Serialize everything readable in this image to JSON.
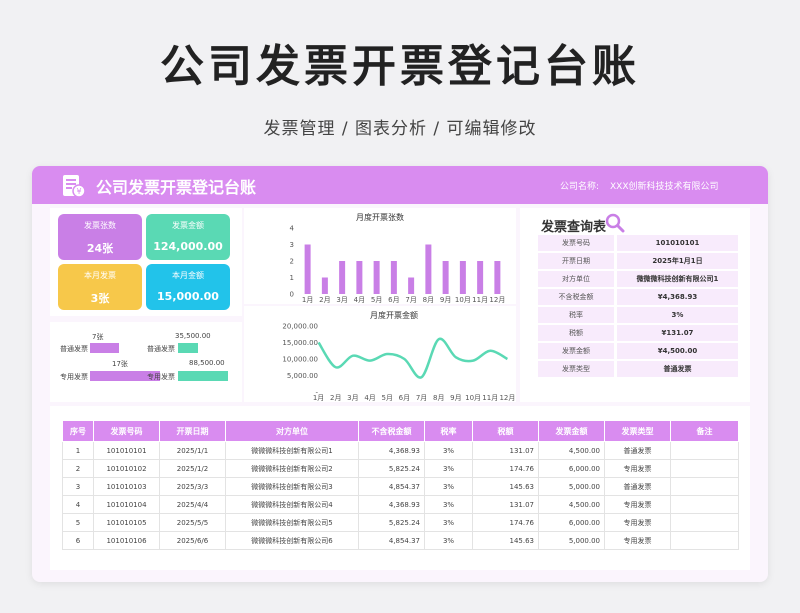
{
  "page": {
    "title": "公司发票开票登记台账",
    "subtitle": "发票管理 / 图表分析 / 可编辑修改"
  },
  "header": {
    "sheet_title": "公司发票开票登记台账",
    "company_label": "公司名称:",
    "company_value": "XXX创新科技技术有限公司"
  },
  "stats": [
    {
      "label": "发票张数",
      "value": "24张",
      "color": "#c97fe6"
    },
    {
      "label": "发票金额",
      "value": "124,000.00",
      "color": "#5ad9b4"
    },
    {
      "label": "本月发票",
      "value": "3张",
      "color": "#f7c84a"
    },
    {
      "label": "本月金额",
      "value": "15,000.00",
      "color": "#22c3ea"
    }
  ],
  "type_bars": [
    {
      "label": "普通发票",
      "count_label": "7张",
      "count": 7,
      "amount_label": "35,500.00",
      "amount": 35500
    },
    {
      "label": "专用发票",
      "count_label": "17张",
      "count": 17,
      "amount_label": "88,500.00",
      "amount": 88500
    }
  ],
  "chart_data": [
    {
      "type": "bar",
      "title": "月度开票张数",
      "categories": [
        "1月",
        "2月",
        "3月",
        "4月",
        "5月",
        "6月",
        "7月",
        "8月",
        "9月",
        "10月",
        "11月",
        "12月"
      ],
      "values": [
        3,
        1,
        2,
        2,
        2,
        2,
        1,
        3,
        2,
        2,
        2,
        2
      ],
      "ylim": [
        0,
        4
      ],
      "yticks": [
        "0",
        "1",
        "2",
        "3",
        "4"
      ],
      "color": "#c97fe6"
    },
    {
      "type": "line",
      "title": "月度开票金额",
      "categories": [
        "1月",
        "2月",
        "3月",
        "4月",
        "5月",
        "6月",
        "7月",
        "8月",
        "9月",
        "10月",
        "11月",
        "12月"
      ],
      "values": [
        15000,
        7500,
        11000,
        9500,
        11500,
        10000,
        4500,
        16000,
        10500,
        9500,
        12500,
        10000
      ],
      "ylim": [
        0,
        20000
      ],
      "yticks": [
        "-",
        "5,000.00",
        "10,000.00",
        "15,000.00",
        "20,000.00"
      ],
      "color": "#5ad9b4"
    }
  ],
  "query": {
    "title": "发票查询表",
    "rows": [
      {
        "key": "发票号码",
        "value": "101010101"
      },
      {
        "key": "开票日期",
        "value": "2025年1月1日"
      },
      {
        "key": "对方单位",
        "value": "微微微科技创新有限公司1"
      },
      {
        "key": "不含税金额",
        "value": "¥4,368.93"
      },
      {
        "key": "税率",
        "value": "3%"
      },
      {
        "key": "税额",
        "value": "¥131.07"
      },
      {
        "key": "发票金额",
        "value": "¥4,500.00"
      },
      {
        "key": "发票类型",
        "value": "普通发票"
      }
    ]
  },
  "table": {
    "headers": [
      "序号",
      "发票号码",
      "开票日期",
      "对方单位",
      "不含税金额",
      "税率",
      "税额",
      "发票金额",
      "发票类型",
      "备注"
    ],
    "rows": [
      [
        "1",
        "101010101",
        "2025/1/1",
        "微微微科技创新有限公司1",
        "4,368.93",
        "3%",
        "131.07",
        "4,500.00",
        "普通发票",
        ""
      ],
      [
        "2",
        "101010102",
        "2025/1/2",
        "微微微科技创新有限公司2",
        "5,825.24",
        "3%",
        "174.76",
        "6,000.00",
        "专用发票",
        ""
      ],
      [
        "3",
        "101010103",
        "2025/3/3",
        "微微微科技创新有限公司3",
        "4,854.37",
        "3%",
        "145.63",
        "5,000.00",
        "普通发票",
        ""
      ],
      [
        "4",
        "101010104",
        "2025/4/4",
        "微微微科技创新有限公司4",
        "4,368.93",
        "3%",
        "131.07",
        "4,500.00",
        "专用发票",
        ""
      ],
      [
        "5",
        "101010105",
        "2025/5/5",
        "微微微科技创新有限公司5",
        "5,825.24",
        "3%",
        "174.76",
        "6,000.00",
        "专用发票",
        ""
      ],
      [
        "6",
        "101010106",
        "2025/6/6",
        "微微微科技创新有限公司6",
        "4,854.37",
        "3%",
        "145.63",
        "5,000.00",
        "专用发票",
        ""
      ]
    ]
  },
  "colors": {
    "accent": "#d98cf0",
    "bar_purple": "#c97fe6",
    "bar_teal": "#5ad9b4"
  }
}
